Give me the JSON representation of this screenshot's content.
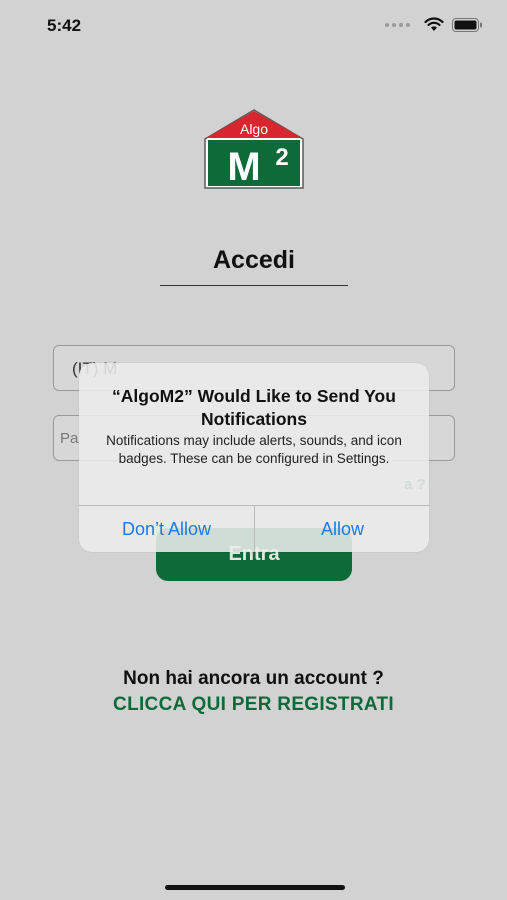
{
  "status_bar": {
    "time": "5:42"
  },
  "logo": {
    "top_text": "Algo",
    "main_text": "M",
    "superscript": "2"
  },
  "login": {
    "title": "Accedi",
    "email_placeholder": "(IT) M",
    "password_placeholder": "Pa",
    "forgot_password_fragment": "a ?",
    "submit_label": "Entra"
  },
  "register": {
    "question": "Non hai ancora un account ?",
    "link": "CLICCA QUI PER REGISTRATI"
  },
  "alert": {
    "title": "“AlgoM2” Would Like to Send You Notifications",
    "message": "Notifications may include alerts, sounds, and icon badges. These can be configured in Settings.",
    "deny_label": "Don’t Allow",
    "allow_label": "Allow"
  },
  "colors": {
    "brand_green": "#0f6a3a",
    "brand_red": "#d8262e",
    "ios_blue": "#1a7ae6"
  },
  "icons": [
    "signal-icon",
    "wifi-icon",
    "battery-icon"
  ]
}
